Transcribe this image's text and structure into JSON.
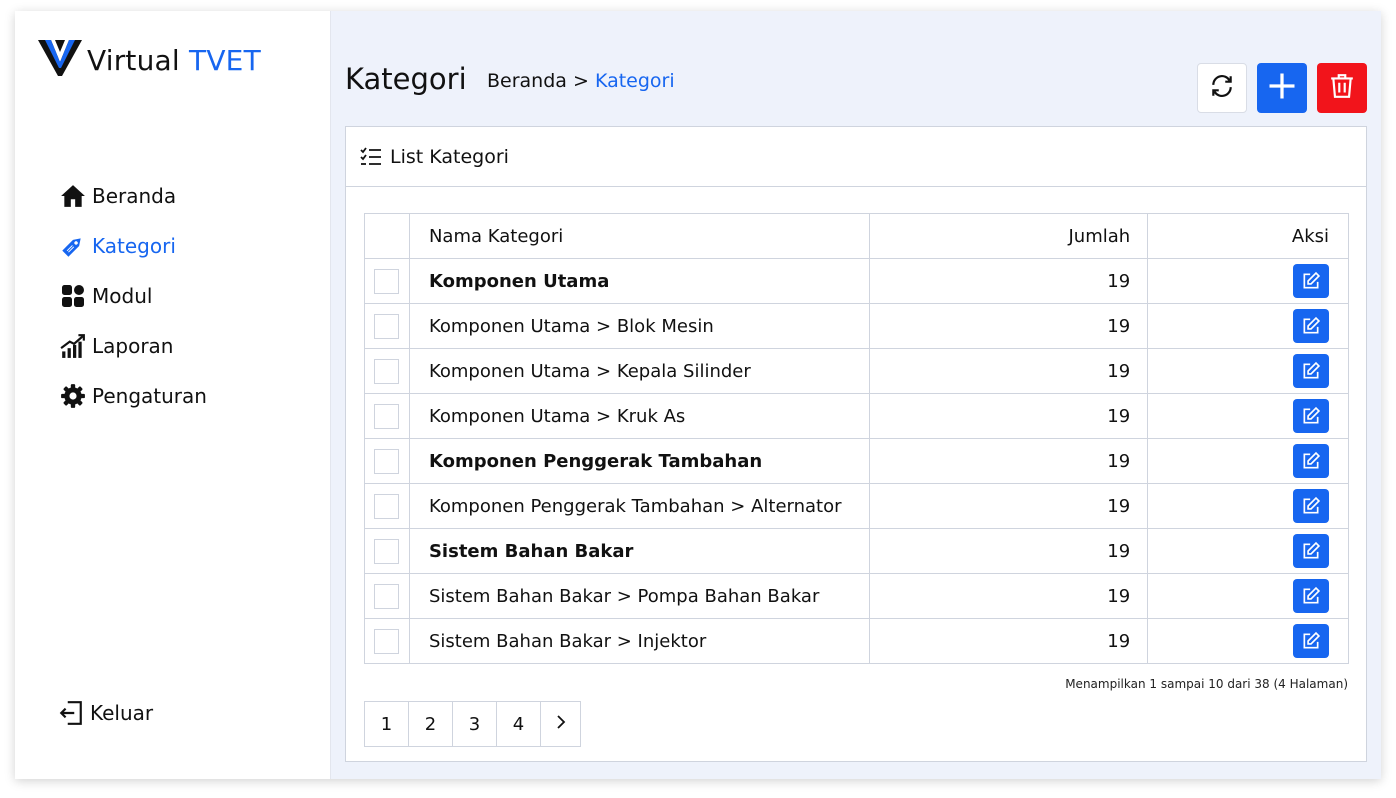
{
  "app": {
    "name_part1": "Virtual",
    "name_part2": "TVET"
  },
  "sidebar": {
    "items": [
      {
        "label": "Beranda",
        "icon": "home-icon",
        "active": false
      },
      {
        "label": "Kategori",
        "icon": "tag-icon",
        "active": true
      },
      {
        "label": "Modul",
        "icon": "grid-icon",
        "active": false
      },
      {
        "label": "Laporan",
        "icon": "chart-icon",
        "active": false
      },
      {
        "label": "Pengaturan",
        "icon": "gear-icon",
        "active": false
      }
    ],
    "logout_label": "Keluar"
  },
  "header": {
    "title": "Kategori",
    "breadcrumb": {
      "home": "Beranda",
      "separator": ">",
      "current": "Kategori"
    }
  },
  "toolbar": {
    "refresh_icon": "refresh-icon",
    "add_icon": "plus-icon",
    "delete_icon": "trash-icon"
  },
  "card": {
    "title": "List Kategori"
  },
  "table": {
    "headers": {
      "name": "Nama Kategori",
      "count": "Jumlah",
      "action": "Aksi"
    },
    "rows": [
      {
        "name": "Komponen Utama",
        "count": "19",
        "bold": true
      },
      {
        "name": "Komponen Utama > Blok Mesin",
        "count": "19",
        "bold": false
      },
      {
        "name": "Komponen Utama > Kepala Silinder",
        "count": "19",
        "bold": false
      },
      {
        "name": "Komponen Utama > Kruk As",
        "count": "19",
        "bold": false
      },
      {
        "name": "Komponen Penggerak Tambahan",
        "count": "19",
        "bold": true
      },
      {
        "name": "Komponen Penggerak Tambahan > Alternator",
        "count": "19",
        "bold": false
      },
      {
        "name": "Sistem Bahan Bakar",
        "count": "19",
        "bold": true
      },
      {
        "name": "Sistem Bahan Bakar > Pompa Bahan Bakar",
        "count": "19",
        "bold": false
      },
      {
        "name": "Sistem Bahan Bakar > Injektor",
        "count": "19",
        "bold": false
      }
    ]
  },
  "summary": "Menampilkan 1 sampai 10 dari 38 (4 Halaman)",
  "pagination": {
    "pages": [
      "1",
      "2",
      "3",
      "4"
    ],
    "next": ">"
  },
  "colors": {
    "primary": "#1766f0",
    "danger": "#f2141b",
    "background": "#eef2fb"
  }
}
